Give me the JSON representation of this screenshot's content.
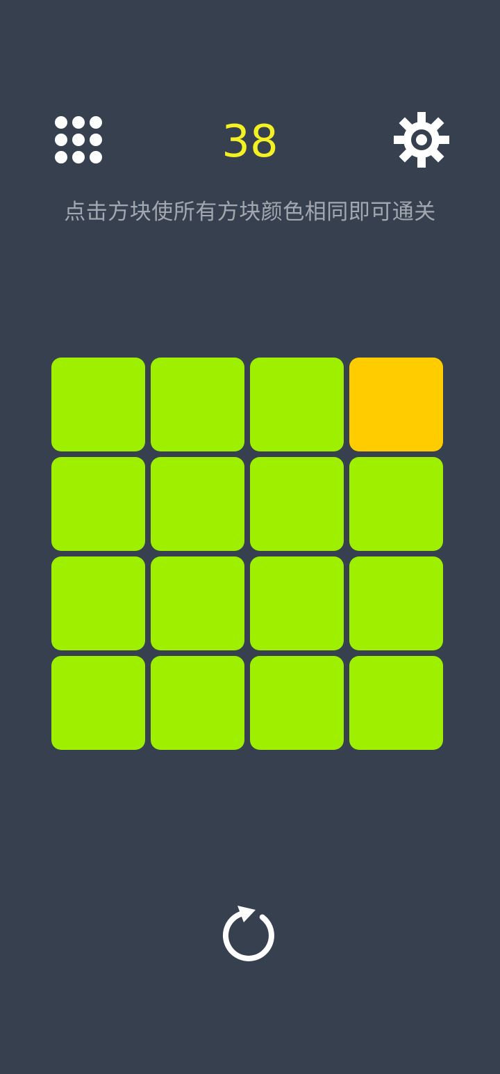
{
  "header": {
    "score": "38",
    "menu_icon": "grid-dots-icon",
    "settings_icon": "gear-icon"
  },
  "instruction": "点击方块使所有方块颜色相同即可通关",
  "board": {
    "rows": 4,
    "cols": 4,
    "tiles": [
      [
        "green",
        "green",
        "green",
        "yellow"
      ],
      [
        "green",
        "green",
        "green",
        "green"
      ],
      [
        "green",
        "green",
        "green",
        "green"
      ],
      [
        "green",
        "green",
        "green",
        "green"
      ]
    ]
  },
  "colors": {
    "background": "#36404e",
    "score": "#f3f023",
    "instruction": "#a3a8b0",
    "green": "#9fef00",
    "yellow": "#ffcc00",
    "icon": "#ffffff"
  },
  "footer": {
    "restart_icon": "restart-icon"
  }
}
